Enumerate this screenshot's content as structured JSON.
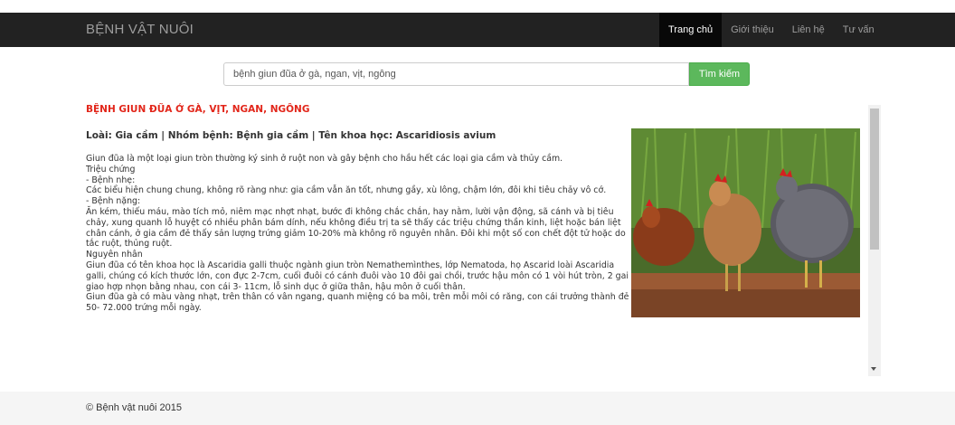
{
  "navbar": {
    "brand": "BỆNH VẬT NUÔI",
    "items": [
      {
        "label": "Trang chủ",
        "active": true
      },
      {
        "label": "Giới thiệu",
        "active": false
      },
      {
        "label": "Liên hệ",
        "active": false
      },
      {
        "label": "Tư vấn",
        "active": false
      }
    ]
  },
  "search": {
    "value": "bệnh giun đũa ở gà, ngan, vịt, ngỗng",
    "button_label": "Tìm kiếm"
  },
  "article": {
    "title": "BỆNH GIUN ĐŨA Ở GÀ, VỊT, NGAN, NGỖNG",
    "meta": "Loài: Gia cầm | Nhóm bệnh: Bệnh gia cầm | Tên khoa học: Ascaridiosis avium",
    "paragraphs": [
      "Giun đũa là một loại giun tròn thường ký sinh ở ruột non và gây bệnh cho hầu hết các loại gia cầm và thủy cầm.",
      "Triệu chứng",
      "- Bệnh nhẹ:",
      "Các biểu hiện chung chung, không rõ ràng như: gia cầm vẫn ăn tốt, nhưng gầy, xù lông, chậm lớn, đôi khi tiêu chảy vô cớ.",
      "- Bệnh nặng:",
      "Ăn kém, thiếu máu, mào tích mỏ, niêm mạc nhợt nhạt, bước đi không chắc chắn, hay nằm, lười vận động, sã cánh và bị tiêu chảy, xung quanh lỗ huyệt có nhiều phân bám dính, nếu không điều trị ta sẽ thấy các triệu chứng thần kinh, liệt hoặc bán liệt chân cánh, ở gia cầm đẻ thấy sản lượng trứng giảm 10-20% mà không rõ nguyên nhân. Đôi khi một số con chết đột tử hoặc do tắc ruột, thủng ruột.",
      "Nguyên nhân",
      "Giun đũa có tên khoa học là Ascaridia galli thuộc ngành giun tròn Nemathemìnthes, lớp Nematoda, họ Ascarid loài Ascaridia galli, chúng có kích thước lớn, con đực 2-7cm, cuối đuôi có cánh đuôi vào 10 đôi gai chồi, trước hậu môn có 1 vòi hút tròn, 2 gai giao hợp nhọn bằng nhau, con cái 3- 11cm, lỗ sinh dục ở giữa thân, hậu môn ở cuối thân.",
      "Giun đũa gà có màu vàng nhạt, trên thân có vân ngang, quanh miệng có ba môi, trên mỗi môi có răng, con cái trưởng thành đẻ 50- 72.000 trứng mỗi ngày."
    ]
  },
  "scroll_fraction": 0.0,
  "footer": {
    "copyright": "© Bệnh vật nuôi 2015"
  }
}
